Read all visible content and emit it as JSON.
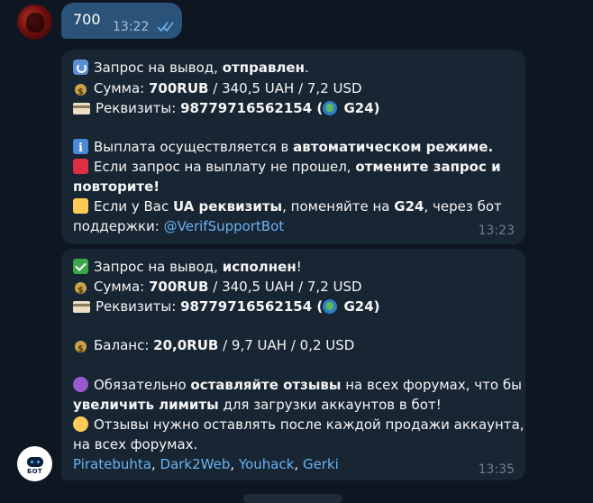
{
  "outgoing": {
    "text": "700",
    "time": "13:22"
  },
  "message1": {
    "l1_pre": "Запрос на вывод, ",
    "l1_bold": "отправлен",
    "l1_post": ".",
    "l2_pre": "Сумма: ",
    "l2_bold": "700RUB",
    "l2_post": "  / 340,5 UAH / 7,2 USD",
    "l3_pre": "Реквизиты: ",
    "l3_bold": "98779716562154 (",
    "l3_bold2": " G24)",
    "l4_pre": "Выплата осуществляется в ",
    "l4_bold": "автоматическом режиме.",
    "l5_pre": "Если запрос на выплату не прошел, ",
    "l5_bold": "отмените запрос и",
    "l6_bold": "повторите!",
    "l7_pre": "Если у Вас ",
    "l7_bold": "UA реквизиты",
    "l7_mid": ", поменяйте на ",
    "l7_bold2": "G24",
    "l7_post": ", через бот",
    "l8_pre": "поддержки: ",
    "l8_link": "@VerifSupportBot",
    "time": "13:23"
  },
  "message2": {
    "l1_pre": "Запрос на вывод, ",
    "l1_bold": "исполнен",
    "l1_post": "!",
    "l2_pre": "Сумма: ",
    "l2_bold": "700RUB",
    "l2_post": "  / 340,5 UAH / 7,2 USD",
    "l3_pre": "Реквизиты: ",
    "l3_bold": "98779716562154 (",
    "l3_bold2": " G24)",
    "l4_pre": "Баланс: ",
    "l4_bold": "20,0RUB",
    "l4_post": "  / 9,7 UAH / 0,2 USD",
    "l5_pre": "Обязательно ",
    "l5_bold": "оставляйте отзывы",
    "l5_post": " на всех форумах, что бы",
    "l6_bold": "увеличить лимиты",
    "l6_post": " для загрузки аккаунтов в бот!",
    "l7": "Отзывы нужно оставлять после каждой продажи аккаунта,",
    "l8": "на всех форумах.",
    "links": [
      "Piratebuhta",
      "Dark2Web",
      "Youhack",
      "Gerki"
    ],
    "sep": ", ",
    "time": "13:35"
  },
  "bot_avatar_label": "БОТ",
  "colors": {
    "background": "#0e1621",
    "bubble_in": "#182533",
    "bubble_out": "#2b5278",
    "link": "#6ab3f3"
  }
}
